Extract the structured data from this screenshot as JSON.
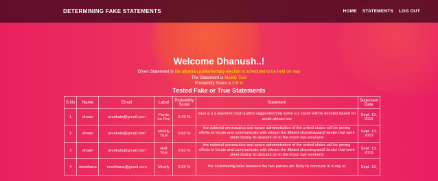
{
  "nav": {
    "brand": "DETERMINING FAKE STATEMENTS",
    "links": [
      "HOME",
      "STATEMENTS",
      "LOG OUT"
    ]
  },
  "welcome": "Welcome Dhanush..!",
  "given": {
    "prefix": "Given Statement is ",
    "statement": "the albanian parliamentary election is scheduled to be held on may",
    "label_prefix": "The Statement is ",
    "label": "Mostly True",
    "score_prefix": "Probability Score is ",
    "score": "0.6 %"
  },
  "subtitle": "Tested Fake or True Statements",
  "table": {
    "headers": [
      "S.No",
      "Name",
      "Email",
      "Label",
      "Probability Score",
      "Statement",
      "Statement Date"
    ],
    "rows": [
      {
        "sno": "1",
        "name": "shaan",
        "email": "arunkata@gmail.com",
        "label": "Pants on Fire",
        "score": "0.43 %",
        "statement": "says a u.s supreme court justice suggested that some u.s cases will be decided based on south african law",
        "date": "Sept. 13, 2019"
      },
      {
        "sno": "2",
        "name": "shaan",
        "email": "arunkata@gmail.com",
        "label": "Mostly True",
        "score": "0.63 %",
        "statement": "the national aeronautics and space administration of the united states will be joining efforts to locate and communicate with vikram the illfated chandrayaan2 lander that went silent during its descent on to the moon last weekend",
        "date": "Sept. 13, 2019"
      },
      {
        "sno": "3",
        "name": "shaan",
        "email": "arunkata@gmail.com",
        "label": "Half True",
        "score": "0.63 %",
        "statement": "the national aeronautics and space administration of the united states will be joining efforts to locate and communicate with vikram the illfated chandrayaan2 lander that went silent during its descent on to the moon last weekend",
        "date": "Sept. 13, 2019"
      },
      {
        "sno": "4",
        "name": "meethana",
        "email": "meethana@gmail.com",
        "label": "Mostly",
        "score": "0.63 %",
        "statement": "the seatsharing talks between the two parties are likely to conclude in a day or",
        "date": "Sept. 13,"
      }
    ]
  },
  "colors": {
    "accent_yellow": "#ffe900",
    "background": "#e91e63",
    "navbar": "#460a1e"
  }
}
